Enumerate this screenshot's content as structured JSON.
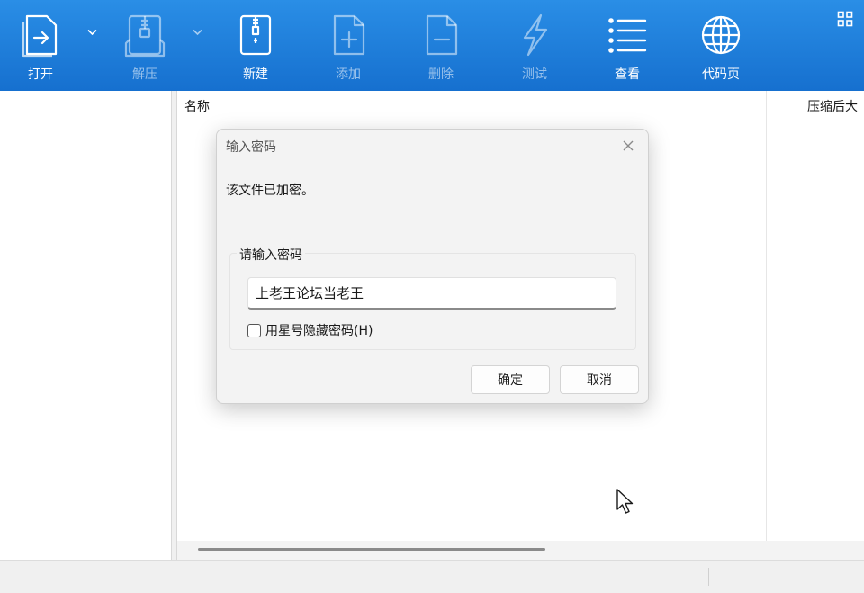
{
  "toolbar": {
    "items": [
      {
        "label": "打开",
        "icon": "open-icon",
        "enabled": true
      },
      {
        "label": "解压",
        "icon": "extract-icon",
        "enabled": false
      },
      {
        "label": "新建",
        "icon": "new-archive-icon",
        "enabled": true
      },
      {
        "label": "添加",
        "icon": "add-file-icon",
        "enabled": false
      },
      {
        "label": "删除",
        "icon": "delete-file-icon",
        "enabled": false
      },
      {
        "label": "测试",
        "icon": "test-lightning-icon",
        "enabled": false
      },
      {
        "label": "查看",
        "icon": "view-list-icon",
        "enabled": true
      },
      {
        "label": "代码页",
        "icon": "globe-icon",
        "enabled": true
      }
    ],
    "menu_icon": "grid-icon"
  },
  "file_list": {
    "columns": [
      "名称",
      "压缩后大"
    ]
  },
  "dialog": {
    "title": "输入密码",
    "message": "该文件已加密。",
    "group_label": "请输入密码",
    "password_value": "上老王论坛当老王",
    "checkbox_label": "用星号隐藏密码(H)",
    "checkbox_checked": false,
    "ok_label": "确定",
    "cancel_label": "取消"
  },
  "colors": {
    "toolbar_top": "#2a8ee6",
    "toolbar_bottom": "#1670cf",
    "dialog_bg": "#f3f3f3"
  }
}
